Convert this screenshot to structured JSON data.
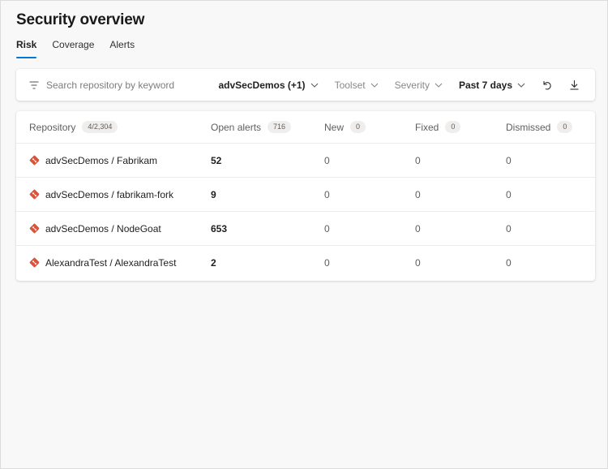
{
  "page": {
    "title": "Security overview"
  },
  "tabs": [
    {
      "label": "Risk",
      "active": true
    },
    {
      "label": "Coverage",
      "active": false
    },
    {
      "label": "Alerts",
      "active": false
    }
  ],
  "filter_bar": {
    "search_placeholder": "Search repository by keyword",
    "project_filter": "advSecDemos (+1)",
    "toolset_filter": "Toolset",
    "severity_filter": "Severity",
    "time_filter": "Past 7 days",
    "icons": [
      "filter-lines-icon",
      "chevron-down-icon",
      "undo-icon",
      "download-icon"
    ]
  },
  "table": {
    "headers": {
      "repository": {
        "label": "Repository",
        "count": "4/2,304"
      },
      "open_alerts": {
        "label": "Open alerts",
        "count": "716"
      },
      "new": {
        "label": "New",
        "count": "0"
      },
      "fixed": {
        "label": "Fixed",
        "count": "0"
      },
      "dismissed": {
        "label": "Dismissed",
        "count": "0"
      }
    },
    "rows": [
      {
        "repo": "advSecDemos / Fabrikam",
        "open": "52",
        "new": "0",
        "fixed": "0",
        "dismissed": "0"
      },
      {
        "repo": "advSecDemos / fabrikam-fork",
        "open": "9",
        "new": "0",
        "fixed": "0",
        "dismissed": "0"
      },
      {
        "repo": "advSecDemos / NodeGoat",
        "open": "653",
        "new": "0",
        "fixed": "0",
        "dismissed": "0"
      },
      {
        "repo": "AlexandraTest / AlexandraTest",
        "open": "2",
        "new": "0",
        "fixed": "0",
        "dismissed": "0"
      }
    ]
  },
  "colors": {
    "accent": "#0078d4",
    "repo_icon": "#e0513a",
    "background": "#f8f8f8"
  }
}
